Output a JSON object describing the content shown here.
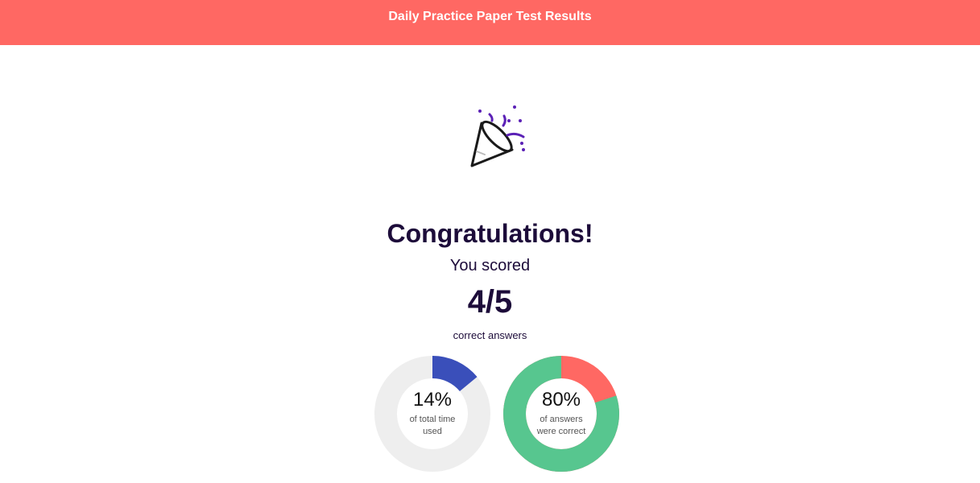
{
  "header": {
    "title": "Daily Practice Paper Test Results",
    "background": "#ff6863"
  },
  "celebration": {
    "icon": "party-popper-icon"
  },
  "result": {
    "heading": "Congratulations!",
    "subheading": "You scored",
    "score": "4/5",
    "caption": "correct answers"
  },
  "stats": [
    {
      "value_text": "14%",
      "label": "of total time used",
      "fraction": 0.14,
      "fill_color": "#3a4fba",
      "track_color": "#eeeeee"
    },
    {
      "value_text": "80%",
      "label": "of answers were correct",
      "fraction": 0.8,
      "fill_color": "#57c68f",
      "track_color": "#ff6863"
    }
  ]
}
